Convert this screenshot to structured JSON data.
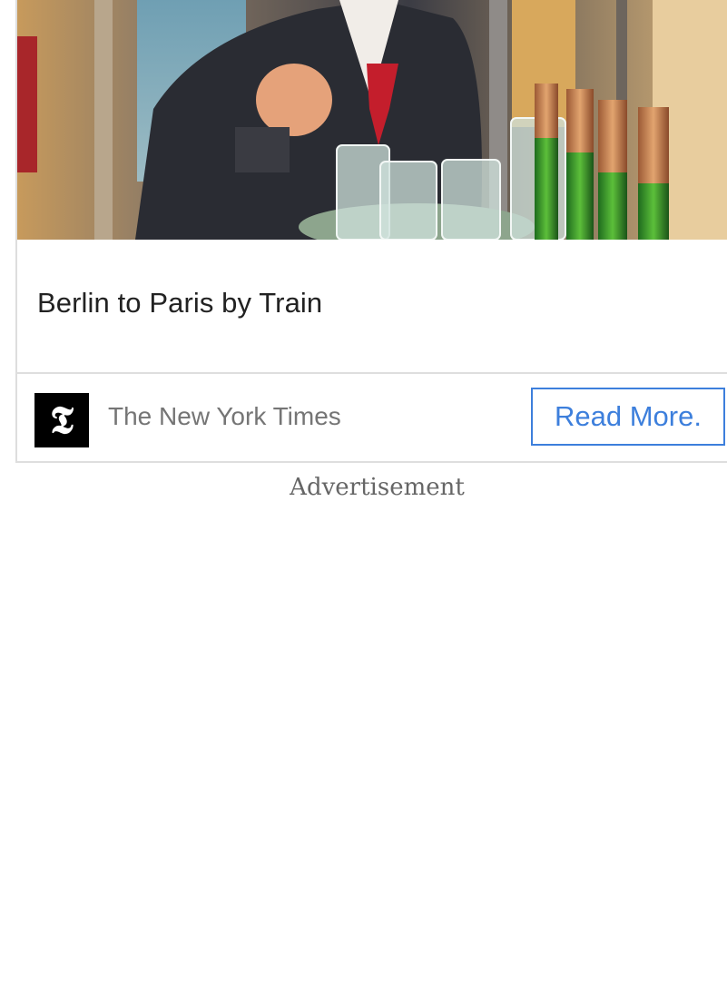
{
  "ad": {
    "image_alt": "Train attendant with tray of glasses and champagne bottles",
    "headline": "Berlin to Paris by Train",
    "publisher_logo_glyph": "𝕿",
    "publisher_name": "The New York Times",
    "cta_label": "Read More."
  },
  "advertisement_label": "Advertisement",
  "colors": {
    "cta_blue": "#3d7fdc",
    "border_gray": "#dedede",
    "publisher_gray": "#757575"
  }
}
